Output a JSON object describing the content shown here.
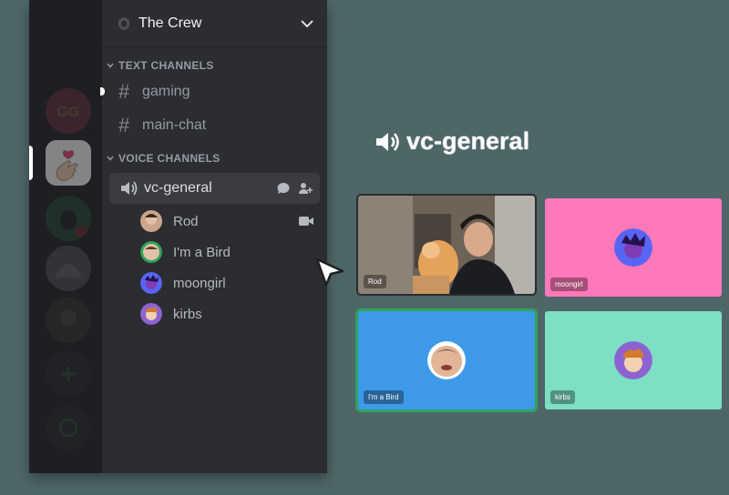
{
  "server": {
    "name": "The Crew"
  },
  "categories": {
    "text": "TEXT CHANNELS",
    "voice": "VOICE CHANNELS"
  },
  "text_channels": [
    {
      "name": "gaming"
    },
    {
      "name": "main-chat"
    }
  ],
  "voice_channel": {
    "name": "vc-general"
  },
  "members": [
    {
      "name": "Rod",
      "camera_on": true
    },
    {
      "name": "I'm a Bird",
      "camera_on": false
    },
    {
      "name": "moongirl",
      "camera_on": false
    },
    {
      "name": "kirbs",
      "camera_on": false
    }
  ],
  "call": {
    "title": "vc-general",
    "tiles": [
      {
        "name": "Rod",
        "color": "#6d6357"
      },
      {
        "name": "moongirl",
        "color": "#ff78b9"
      },
      {
        "name": "I'm a Bird",
        "color": "#3e9ae9"
      },
      {
        "name": "kirbs",
        "color": "#7ddfc3"
      }
    ]
  },
  "colors": {
    "background": "#4f6669",
    "sidebar": "#2b2d31",
    "rail": "#1e1f22",
    "speaking_outline": "#2fa45c"
  }
}
